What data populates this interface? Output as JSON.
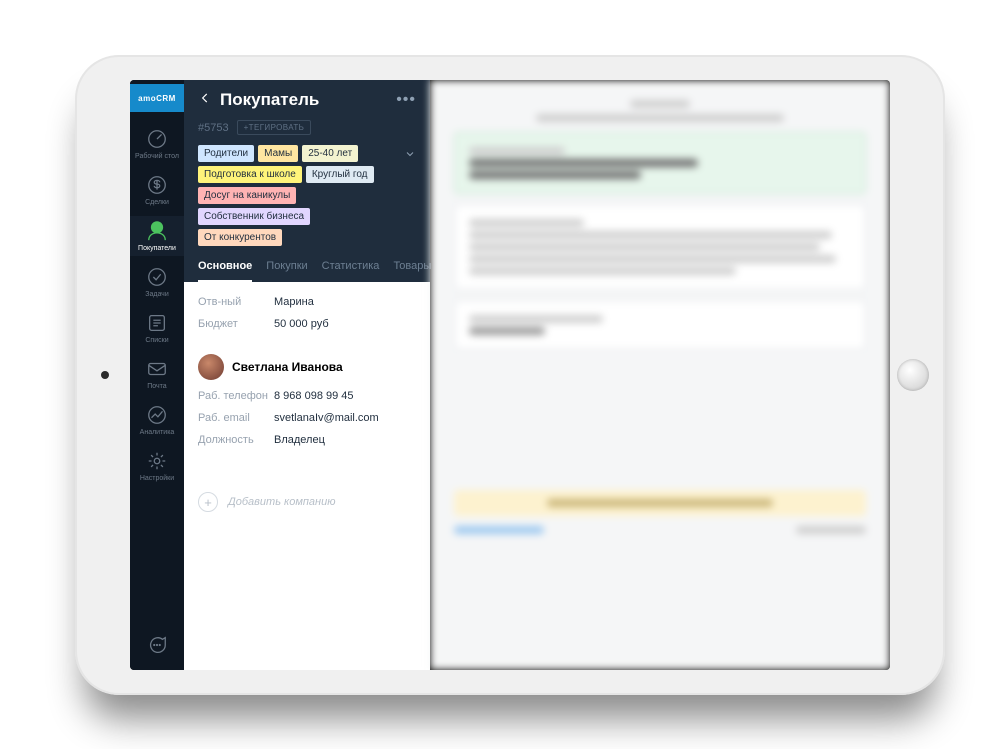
{
  "brand": "amoCRM",
  "sidebar": {
    "items": [
      {
        "id": "desktop",
        "label": "Рабочий стол"
      },
      {
        "id": "deals",
        "label": "Сделки"
      },
      {
        "id": "buyers",
        "label": "Покупатели",
        "active": true
      },
      {
        "id": "tasks",
        "label": "Задачи"
      },
      {
        "id": "lists",
        "label": "Списки"
      },
      {
        "id": "mail",
        "label": "Почта"
      },
      {
        "id": "analytics",
        "label": "Аналитика"
      },
      {
        "id": "settings",
        "label": "Настройки"
      }
    ]
  },
  "header": {
    "title": "Покупатель",
    "record_id": "#5753",
    "tag_button": "+ТЕГИРОВАТЬ"
  },
  "tags": [
    {
      "label": "Родители",
      "color": "#cfe6ff"
    },
    {
      "label": "Мамы",
      "color": "#ffe6a1"
    },
    {
      "label": "25-40 лет",
      "color": "#f3f3d0"
    },
    {
      "label": "Подготовка к школе",
      "color": "#fff47a"
    },
    {
      "label": "Круглый год",
      "color": "#dfeaf3"
    },
    {
      "label": "Досуг на каникулы",
      "color": "#ffb3b3"
    },
    {
      "label": "Собственник бизнеса",
      "color": "#e1d6ff"
    },
    {
      "label": "От конкурентов",
      "color": "#ffd8bd"
    }
  ],
  "tabs": [
    {
      "id": "main",
      "label": "Основное",
      "active": true
    },
    {
      "id": "buys",
      "label": "Покупки"
    },
    {
      "id": "stats",
      "label": "Статистика"
    },
    {
      "id": "goods",
      "label": "Товары"
    }
  ],
  "fields": {
    "responsible": {
      "label": "Отв-ный",
      "value": "Марина"
    },
    "budget": {
      "label": "Бюджет",
      "value": "50 000 руб"
    }
  },
  "contact": {
    "name": "Светлана Иванова",
    "fields": {
      "work_phone": {
        "label": "Раб. телефон",
        "value": "8 968 098 99 45"
      },
      "work_email": {
        "label": "Раб. email",
        "value": "svetlanaIv@mail.com"
      },
      "position": {
        "label": "Должность",
        "value": "Владелец"
      }
    }
  },
  "add_company_label": "Добавить компанию"
}
